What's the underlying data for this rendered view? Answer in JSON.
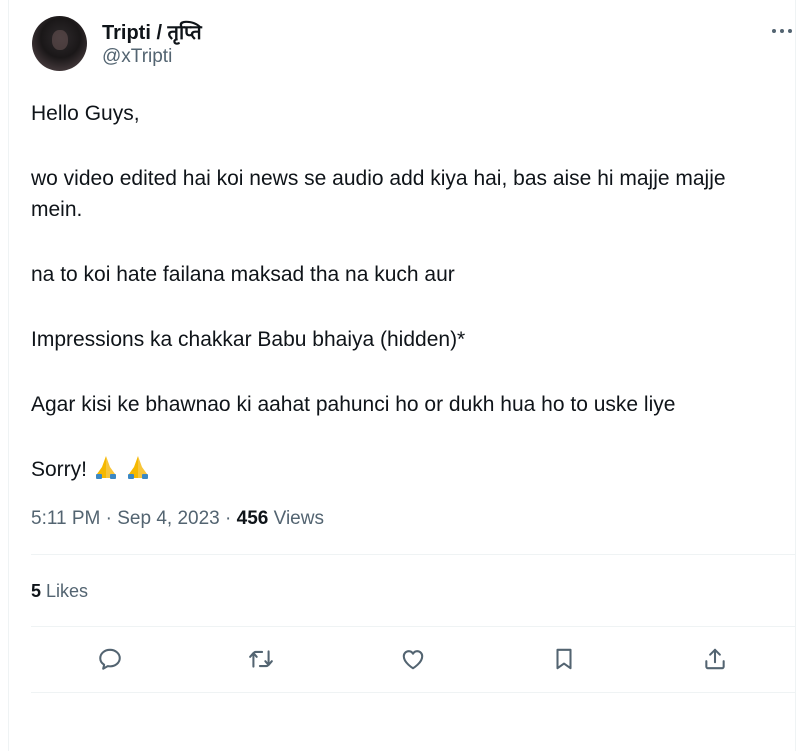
{
  "author": {
    "display_name": "Tripti / तृप्ति",
    "handle": "@xTripti"
  },
  "tweet": {
    "paragraphs": [
      "Hello Guys,",
      "wo video edited hai koi news se audio add kiya hai, bas aise hi majje majje mein.",
      "na to koi hate failana maksad tha na kuch aur",
      "Impressions ka chakkar Babu bhaiya (hidden)*",
      "Agar kisi ke bhawnao ki aahat pahunci ho or dukh hua ho to uske liye",
      "Sorry!"
    ],
    "emojis": [
      "🙏",
      "🙏"
    ]
  },
  "meta": {
    "time": "5:11 PM",
    "separator": "·",
    "date": "Sep 4, 2023",
    "views_count": "456",
    "views_label": "Views"
  },
  "engagement": {
    "likes_count": "5",
    "likes_label": "Likes"
  },
  "actions": {
    "icons": [
      "reply-icon",
      "retweet-icon",
      "like-icon",
      "bookmark-icon",
      "share-icon"
    ]
  },
  "colors": {
    "text_primary": "#0f1419",
    "text_secondary": "#536471",
    "divider": "#eff3f4",
    "emoji_skin": "#f5b800",
    "emoji_sleeve": "#3b88c3"
  }
}
